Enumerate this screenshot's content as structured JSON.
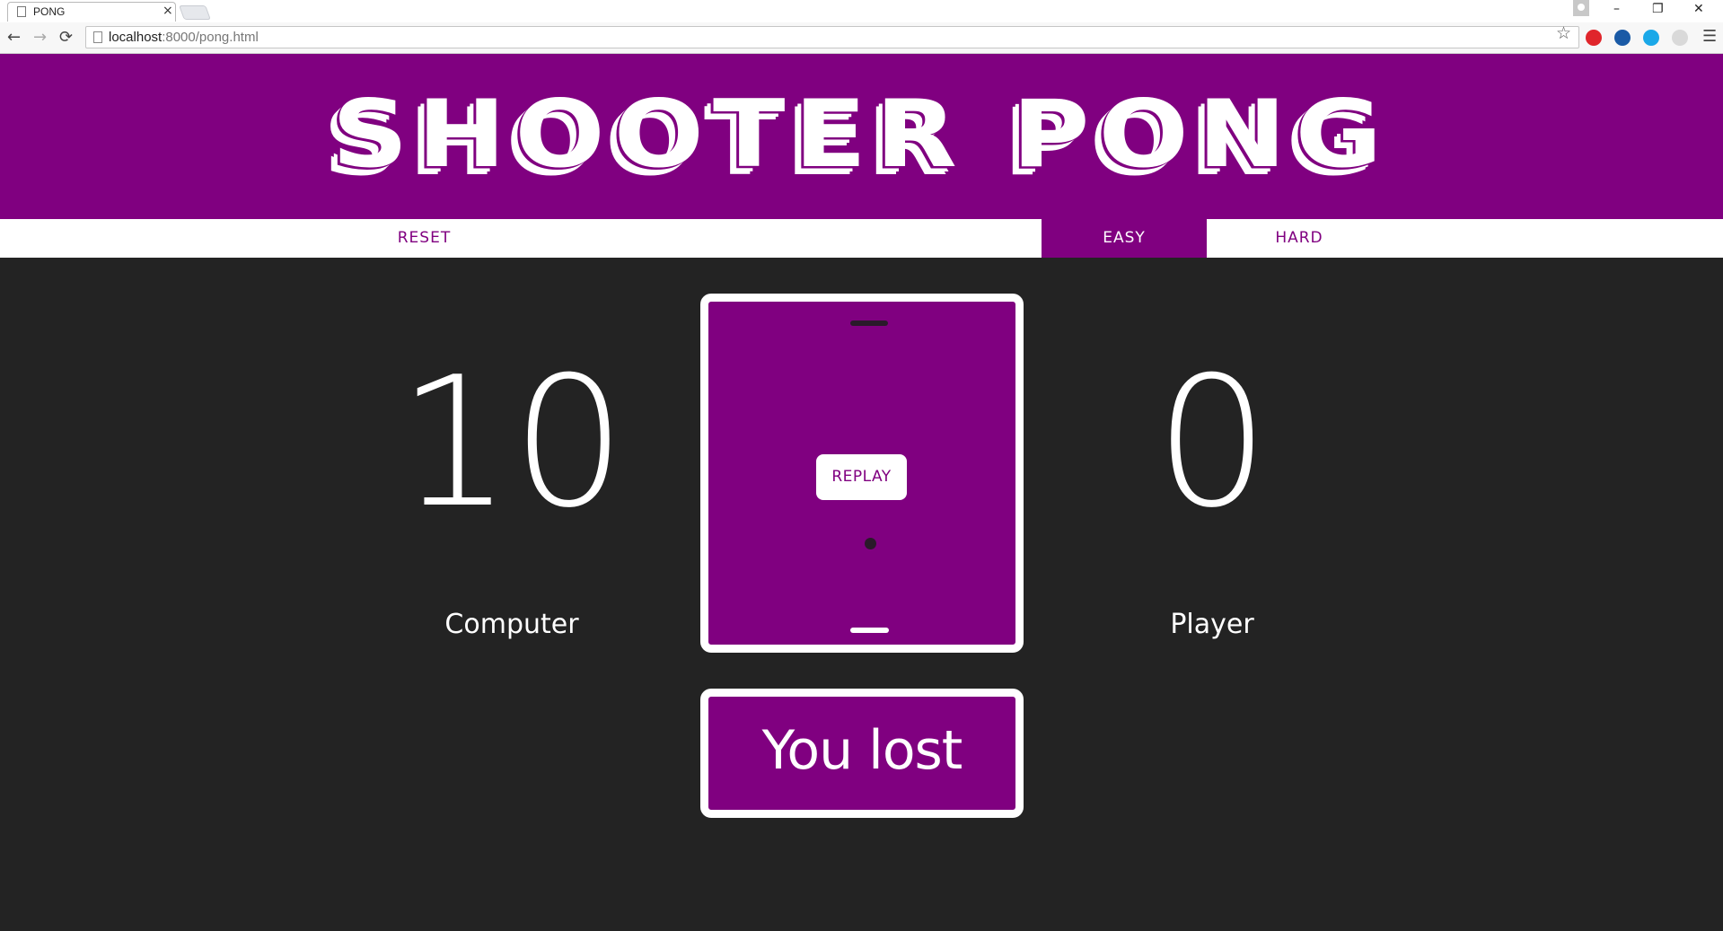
{
  "browser": {
    "tab_title": "PONG",
    "tab_close": "×",
    "url_host": "localhost",
    "url_rest": ":8000/pong.html",
    "window_controls": {
      "minimize": "–",
      "restore": "❐",
      "close": "✕"
    },
    "nav": {
      "back": "←",
      "forward": "→",
      "reload": "⟳"
    },
    "star": "☆",
    "menu": "☰",
    "extensions": [
      {
        "name": "opera-icon",
        "color": "#e0252b"
      },
      {
        "name": "chrome-extension-icon",
        "color": "#1a5aa6"
      },
      {
        "name": "skype-icon",
        "color": "#1aa8e8"
      },
      {
        "name": "extension-icon",
        "color": "#d9d9d9"
      }
    ]
  },
  "page": {
    "logo": "SHOOTER PONG",
    "nav": {
      "reset": "RESET",
      "easy": "EASY",
      "hard": "HARD"
    },
    "computer_score": "10",
    "computer_label": "Computer",
    "player_score": "0",
    "player_label": "Player",
    "replay": "REPLAY",
    "message": "You lost",
    "colors": {
      "purple": "#800080",
      "background": "#232323",
      "white": "#ffffff",
      "ball": "#2a1a2a"
    }
  }
}
